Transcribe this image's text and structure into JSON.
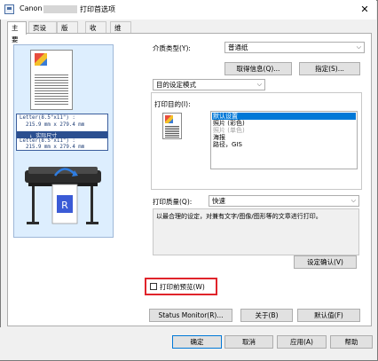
{
  "window": {
    "title_prefix": "Canon",
    "title_suffix": "打印首选项",
    "close_glyph": "✕"
  },
  "tabs": [
    {
      "label": "主要",
      "active": true
    },
    {
      "label": "页设置",
      "active": false
    },
    {
      "label": "版式",
      "active": false
    },
    {
      "label": "收藏",
      "active": false
    },
    {
      "label": "维护",
      "active": false
    }
  ],
  "preview": {
    "size_line1": "Letter(8.5\"x11\") :",
    "size_line2": "  215.9 mm x 279.4 mm",
    "actual_size": "↓ 实际尺寸",
    "size_line3": "Letter(8.5\"x11\") :",
    "size_line4": "  215.9 mm x 279.4 mm"
  },
  "media": {
    "label": "介质类型(Y):",
    "value": "普通纸",
    "get_info_button": "取得信息(Q)...",
    "specify_button": "指定(S)..."
  },
  "purpose": {
    "mode_value": "目的设定模式",
    "label": "打印目的(I):",
    "options": [
      {
        "label": "默认设置",
        "selected": true,
        "disabled": false
      },
      {
        "label": "照片 (彩色)",
        "selected": false,
        "disabled": false
      },
      {
        "label": "照片 (单色)",
        "selected": false,
        "disabled": true
      },
      {
        "label": "海报",
        "selected": false,
        "disabled": false
      },
      {
        "label": "路径，GIS",
        "selected": false,
        "disabled": false
      }
    ]
  },
  "quality": {
    "label": "打印质量(Q):",
    "value": "快速",
    "description": "以最合理的设定，对兼有文字/图像/图形等的文章进行打印。",
    "confirm_button": "设定确认(V)"
  },
  "preview_checkbox": {
    "label": "打印前预览(W)",
    "checked": false
  },
  "row_buttons": {
    "status_monitor": "Status Monitor(R)...",
    "about": "关于(B)",
    "defaults": "默认值(F)"
  },
  "dialog_buttons": {
    "ok": "确定",
    "cancel": "取消",
    "apply": "应用(A)",
    "help": "帮助"
  },
  "colors": {
    "accent": "#0078d7",
    "highlight_border": "#e0242b",
    "preview_bg": "#ddeefe"
  }
}
